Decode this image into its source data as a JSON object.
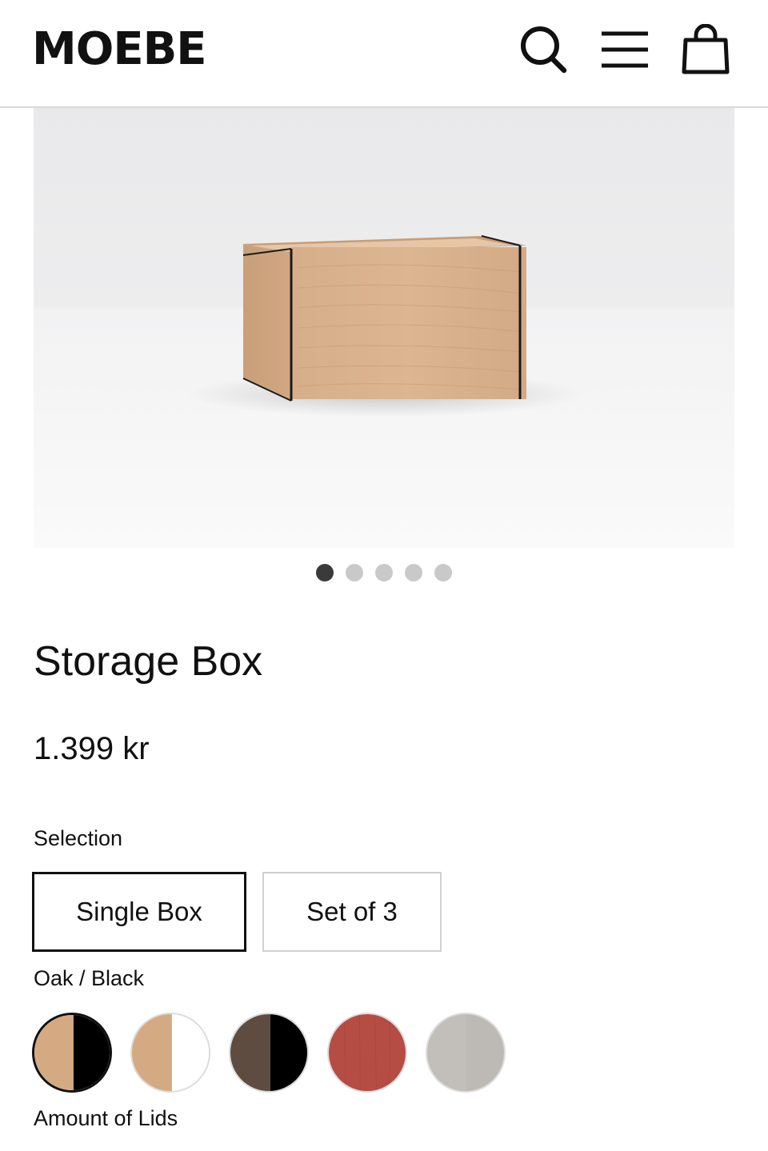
{
  "header": {
    "logo": "MOEBE",
    "icons": [
      "search-icon",
      "menu-icon",
      "shopping-bag-icon"
    ]
  },
  "gallery": {
    "slide_count": 5,
    "active_index": 0
  },
  "product": {
    "title": "Storage Box",
    "price": "1.399 kr"
  },
  "selection": {
    "label": "Selection",
    "options": [
      {
        "label": "Single Box",
        "selected": true
      },
      {
        "label": "Set of 3",
        "selected": false
      }
    ]
  },
  "color": {
    "selected_label": "Oak / Black",
    "swatches": [
      {
        "name": "Oak / Black",
        "colors": [
          "#d4aa83",
          "#000000"
        ],
        "selected": true
      },
      {
        "name": "Oak / White",
        "colors": [
          "#d4aa83",
          "#ffffff"
        ],
        "selected": false
      },
      {
        "name": "Smoked Oak / Black",
        "colors": [
          "#5f4c40",
          "#000000"
        ],
        "selected": false
      },
      {
        "name": "Red",
        "colors": [
          "#b54d45"
        ],
        "selected": false
      },
      {
        "name": "Grey",
        "colors": [
          "#bdb9b4"
        ],
        "selected": false
      }
    ]
  },
  "lids": {
    "label": "Amount of Lids"
  }
}
